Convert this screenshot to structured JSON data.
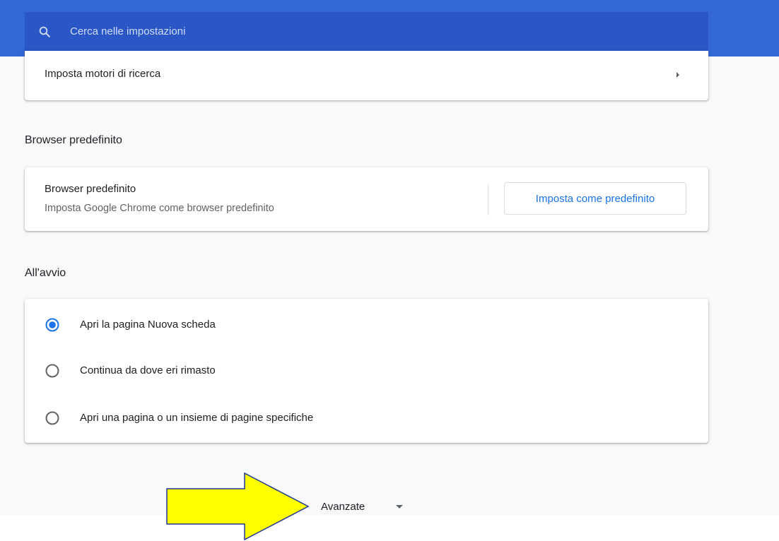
{
  "search": {
    "placeholder": "Cerca nelle impostazioni",
    "icon": "search-icon"
  },
  "search_engine": {
    "row_label": "Imposta motori di ricerca",
    "icon": "arrow-right-icon"
  },
  "default_browser": {
    "section_title": "Browser predefinito",
    "row_label": "Browser predefinito",
    "row_sublabel": "Imposta Google Chrome come browser predefinito",
    "button_label": "Imposta come predefinito"
  },
  "startup": {
    "section_title": "All'avvio",
    "options": [
      {
        "label": "Apri la pagina Nuova scheda",
        "selected": true
      },
      {
        "label": "Continua da dove eri rimasto",
        "selected": false
      },
      {
        "label": "Apri una pagina o un insieme di pagine specifiche",
        "selected": false
      }
    ]
  },
  "advanced": {
    "label": "Avanzate",
    "icon": "caret-down-icon"
  },
  "colors": {
    "header_blue": "#3367d6",
    "search_box_blue": "#2a56c6",
    "accent_blue": "#1a73e8",
    "annotation_arrow_fill": "#ffff00",
    "annotation_arrow_stroke": "#1f3a93"
  }
}
